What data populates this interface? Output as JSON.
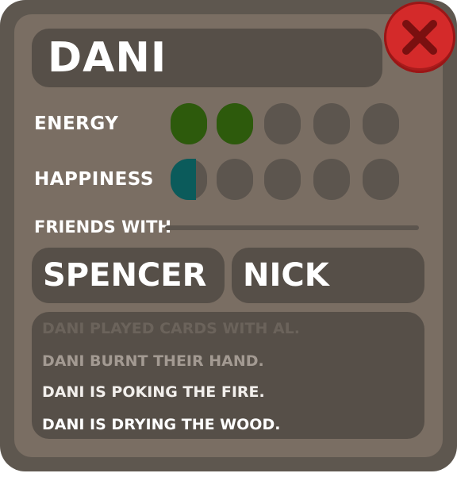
{
  "character": {
    "name": "DANI"
  },
  "stats": [
    {
      "label": "ENERGY",
      "value": 2,
      "max": 5,
      "fill_color": "#2d5a0c"
    },
    {
      "label": "HAPPINESS",
      "value": 0.7,
      "max": 5,
      "fill_color": "#0b5b5b"
    }
  ],
  "friends": {
    "label": "FRIENDS WITH",
    "names": [
      "SPENCER",
      "NICK"
    ]
  },
  "log": [
    {
      "text": "DANI PLAYED CARDS WITH AL.",
      "color": "#6b635b"
    },
    {
      "text": "DANI BURNT THEIR HAND.",
      "color": "#a39a92"
    },
    {
      "text": "DANI IS POKING THE FIRE.",
      "color": "#f2efec"
    },
    {
      "text": "DANI IS DRYING THE WOOD.",
      "color": "#ffffff"
    }
  ],
  "close_button": {
    "icon": "close-icon",
    "color": "#d42a2a"
  }
}
